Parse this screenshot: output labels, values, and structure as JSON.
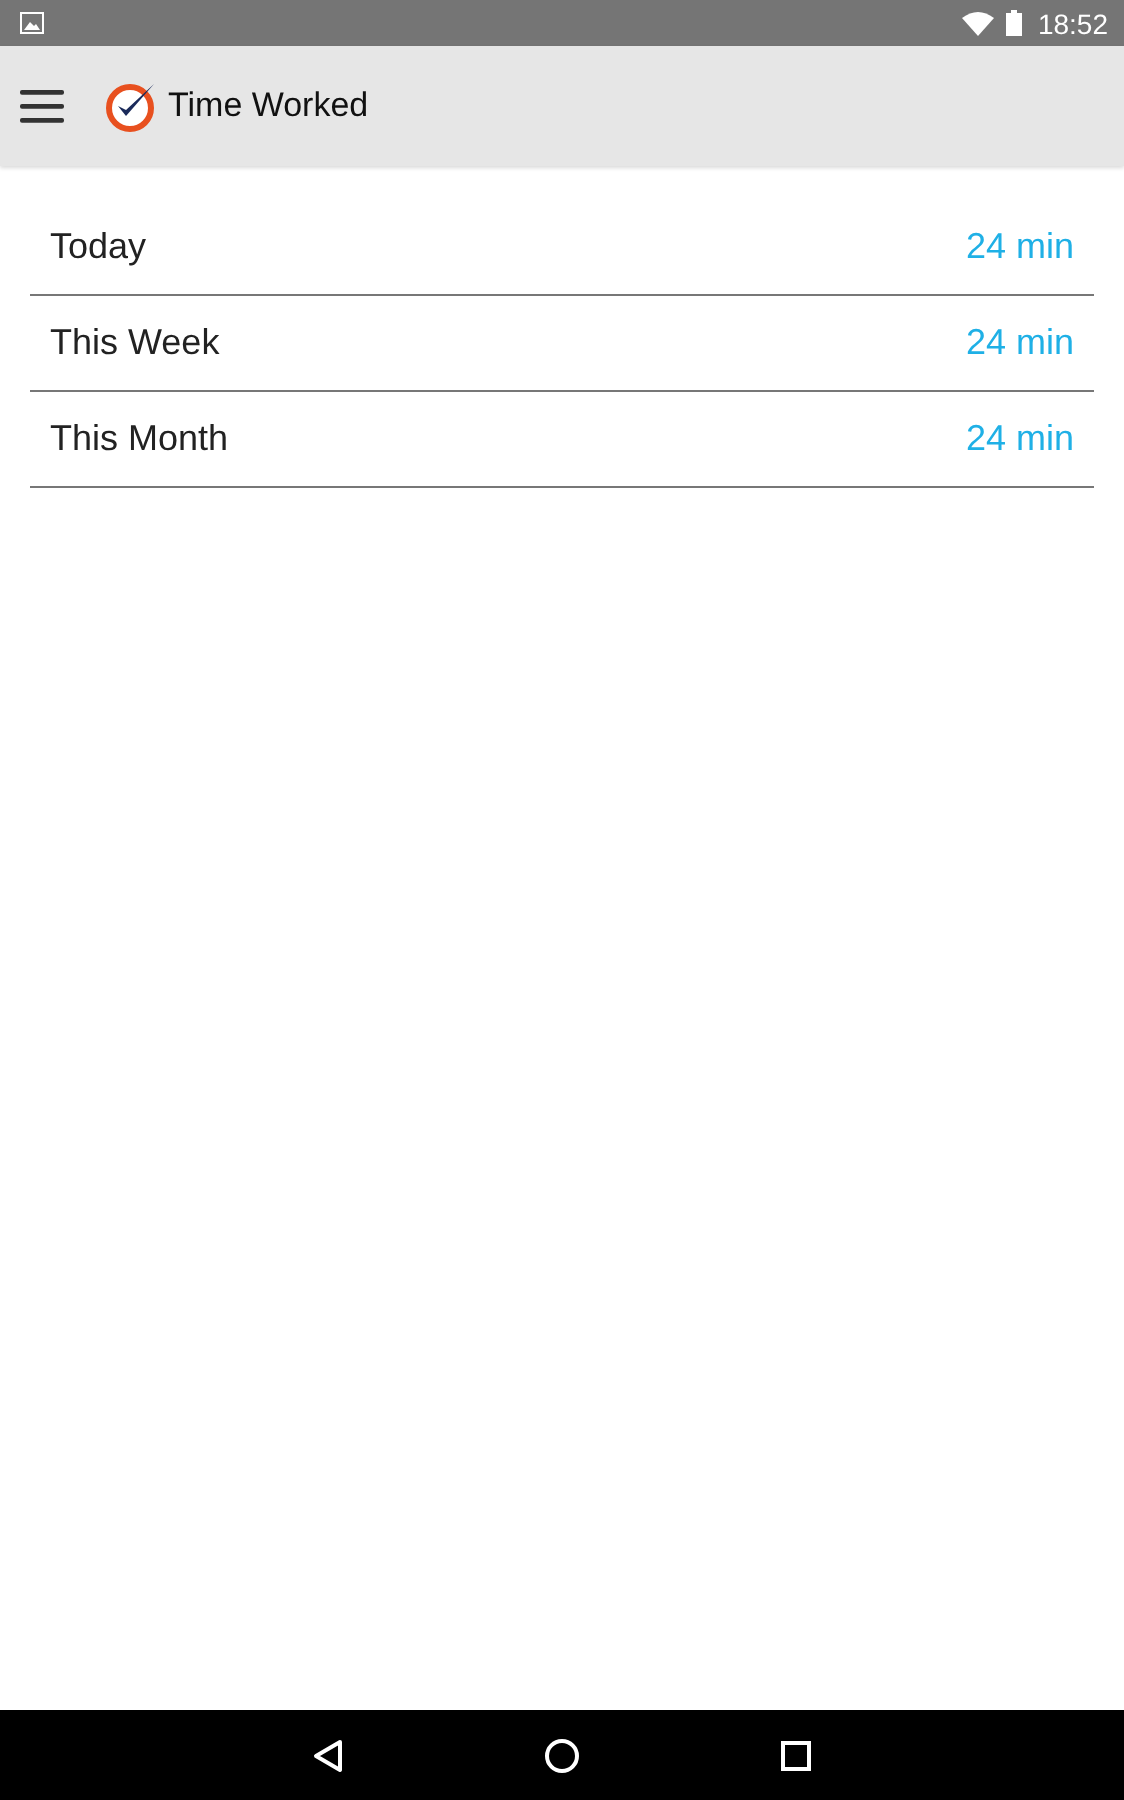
{
  "status_bar": {
    "time": "18:52"
  },
  "app_bar": {
    "title": "Time Worked"
  },
  "rows": [
    {
      "label": "Today",
      "value": "24 min"
    },
    {
      "label": "This Week",
      "value": "24 min"
    },
    {
      "label": "This Month",
      "value": "24 min"
    }
  ]
}
